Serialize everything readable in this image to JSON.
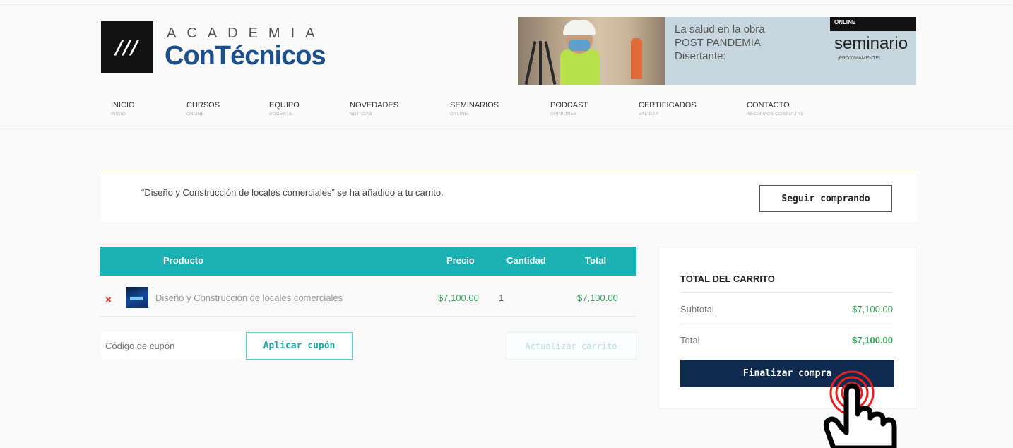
{
  "header": {
    "logo_mark": "///",
    "logo_top": "ACADEMIA",
    "logo_name": "ConTécnicos"
  },
  "banner": {
    "line1": "La salud en la obra",
    "line2": "POST PANDEMIA",
    "line3": "Disertante:",
    "badge": "ONLINE",
    "title": "seminario",
    "subtitle": "¡PRÓXIMAMENTE!"
  },
  "nav": [
    {
      "label": "INICIO",
      "sub": "INICIO"
    },
    {
      "label": "CURSOS",
      "sub": "ONLINE"
    },
    {
      "label": "EQUIPO",
      "sub": "DOCENTE"
    },
    {
      "label": "NOVEDADES",
      "sub": "NOTICIAS"
    },
    {
      "label": "SEMINARIOS",
      "sub": "ONLINE"
    },
    {
      "label": "PODCAST",
      "sub": "OPINIONES"
    },
    {
      "label": "CERTIFICADOS",
      "sub": "VALIDAR"
    },
    {
      "label": "CONTACTO",
      "sub": "RECIBIMOS CONSULTAS"
    }
  ],
  "notice": {
    "message": "“Diseño y Construcción de locales comerciales” se ha añadido a tu carrito.",
    "button": "Seguir comprando"
  },
  "cart": {
    "headers": {
      "product": "Producto",
      "price": "Precio",
      "qty": "Cantidad",
      "total": "Total"
    },
    "items": [
      {
        "remove": "×",
        "name": "Diseño y Construcción de locales comerciales",
        "price": "$7,100.00",
        "qty": "1",
        "total": "$7,100.00"
      }
    ],
    "coupon_placeholder": "Código de cupón",
    "apply_coupon": "Aplicar cupón",
    "update_cart": "Actualizar carrito"
  },
  "totals": {
    "title": "TOTAL DEL CARRITO",
    "subtotal_label": "Subtotal",
    "subtotal_value": "$7,100.00",
    "total_label": "Total",
    "total_value": "$7,100.00",
    "checkout": "Finalizar compra"
  },
  "colors": {
    "accent_teal": "#1cb1b4",
    "brand_blue": "#1d4f8d",
    "checkout_navy": "#0e2a4e",
    "price_green": "#3aa55c",
    "remove_red": "#d22222"
  },
  "icons": {
    "remove": "close-icon",
    "pointer": "hand-pointer-icon"
  }
}
